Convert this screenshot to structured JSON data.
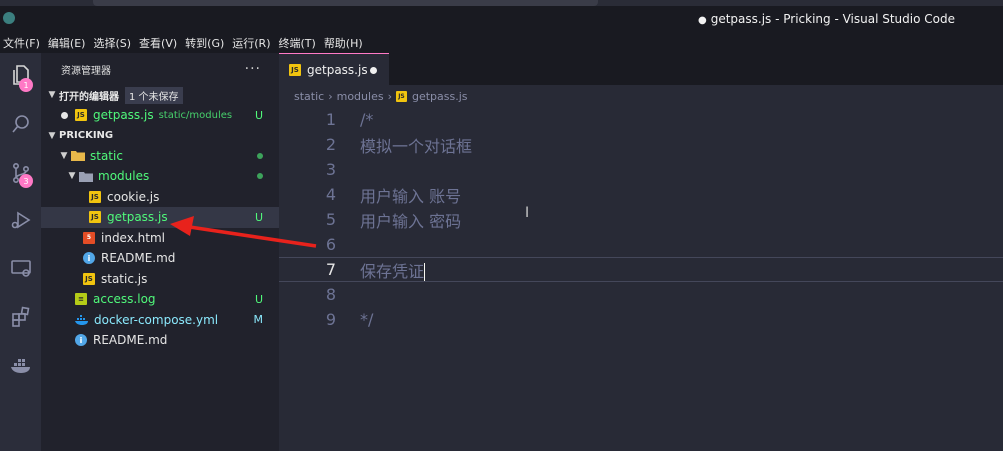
{
  "window": {
    "title_dot": "●",
    "title": "getpass.js - Pricking - Visual Studio Code"
  },
  "menu": [
    "文件(F)",
    "编辑(E)",
    "选择(S)",
    "查看(V)",
    "转到(G)",
    "运行(R)",
    "终端(T)",
    "帮助(H)"
  ],
  "activity": {
    "explorer_badge": "1",
    "scm_badge": "3"
  },
  "sidebar": {
    "title": "资源管理器",
    "more": "···",
    "open_editors": {
      "label": "打开的编辑器",
      "unsaved": "1 个未保存",
      "item": {
        "name": "getpass.js",
        "path": "static/modules",
        "status": "U"
      }
    },
    "project": {
      "label": "PRICKING",
      "items": [
        {
          "name": "static",
          "status": ""
        },
        {
          "name": "modules",
          "status": ""
        },
        {
          "name": "cookie.js",
          "status": ""
        },
        {
          "name": "getpass.js",
          "status": "U"
        },
        {
          "name": "index.html",
          "status": ""
        },
        {
          "name": "README.md",
          "status": ""
        },
        {
          "name": "static.js",
          "status": ""
        },
        {
          "name": "access.log",
          "status": "U"
        },
        {
          "name": "docker-compose.yml",
          "status": "M"
        },
        {
          "name": "README.md",
          "status": ""
        }
      ]
    }
  },
  "editor": {
    "tab": "getpass.js",
    "breadcrumb": [
      "static",
      "modules",
      "getpass.js"
    ],
    "lines": [
      {
        "n": "1",
        "text": "/*"
      },
      {
        "n": "2",
        "text": "模拟一个对话框"
      },
      {
        "n": "3",
        "text": ""
      },
      {
        "n": "4",
        "text": "用户输入 账号"
      },
      {
        "n": "5",
        "text": "用户输入 密码"
      },
      {
        "n": "6",
        "text": ""
      },
      {
        "n": "7",
        "text": "保存凭证"
      },
      {
        "n": "8",
        "text": ""
      },
      {
        "n": "9",
        "text": "*/"
      }
    ],
    "current_line": 7
  },
  "colors": {
    "accent": "#ff79c6",
    "untracked": "#50fa7b",
    "modified": "#8be9fd",
    "annotation_arrow": "#e8221c"
  }
}
